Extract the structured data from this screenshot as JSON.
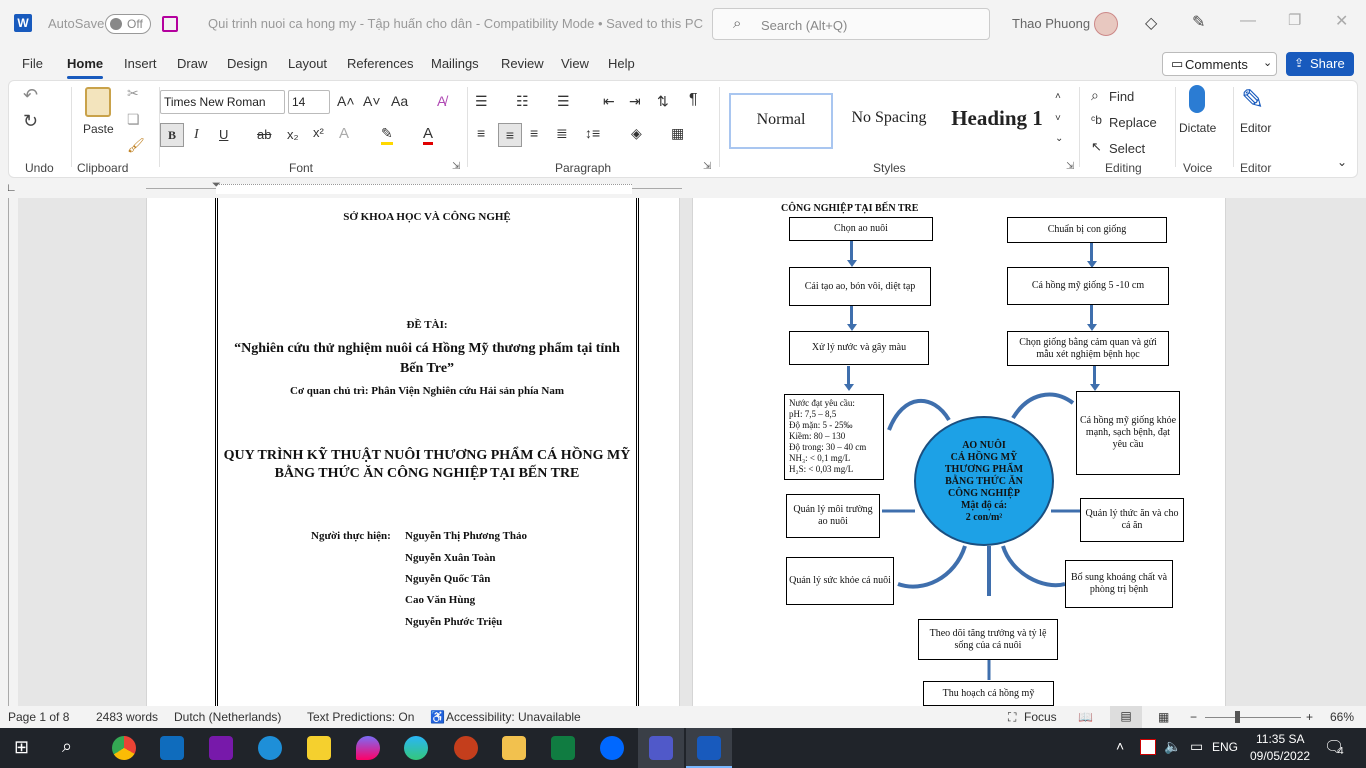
{
  "titlebar": {
    "autosave_label": "AutoSave",
    "autosave_state": "Off",
    "doc_title": "Qui trinh nuoi ca hong my - Tập huấn cho dân  -  Compatibility Mode • Saved to this PC",
    "search_placeholder": "Search (Alt+Q)",
    "user_name": "Thao Phuong"
  },
  "menu": [
    "File",
    "Home",
    "Insert",
    "Draw",
    "Design",
    "Layout",
    "References",
    "Mailings",
    "Review",
    "View",
    "Help"
  ],
  "comments_label": "Comments",
  "share_label": "Share",
  "ribbon": {
    "undo_group": "Undo",
    "clipboard_group": "Clipboard",
    "paste_label": "Paste",
    "font_group": "Font",
    "font_name": "Times New Roman",
    "font_size": "14",
    "paragraph_group": "Paragraph",
    "styles_group": "Styles",
    "styles": [
      "Normal",
      "No Spacing",
      "Heading 1"
    ],
    "editing_group": "Editing",
    "find_label": "Find",
    "replace_label": "Replace",
    "select_label": "Select",
    "voice_group": "Voice",
    "dictate_label": "Dictate",
    "editor_group": "Editor",
    "editor_label": "Editor"
  },
  "page1": {
    "org": "SỞ KHOA HỌC VÀ CÔNG NGHỆ",
    "topic_label": "ĐỀ TÀI:",
    "topic_line1": "“Nghiên cứu thử nghiệm nuôi cá Hồng Mỹ thương phẩm tại tỉnh",
    "topic_line2": "Bến Tre”",
    "host": "Cơ quan chủ trì: Phân Viện Nghiên cứu Hải sản phía Nam",
    "title_line1": "QUY TRÌNH KỸ THUẬT NUÔI THƯƠNG PHẨM CÁ HỒNG MỸ",
    "title_line2": "BẰNG THỨC ĂN CÔNG NGHIỆP TẠI BẾN TRE",
    "authors_label": "Người thực hiện:",
    "authors": [
      "Nguyễn Thị Phương Thảo",
      "Nguyễn Xuân Toàn",
      "Nguyễn Quốc Tân",
      "Cao Văn Hùng",
      "Nguyễn Phước Triệu"
    ]
  },
  "page2": {
    "heading": "CÔNG NGHIỆP TẠI BẾN TRE",
    "box_chon_ao": "Chọn ao nuôi",
    "box_chuan_bi": "Chuẩn bị con giống",
    "box_cai_tao": "Cải tạo ao, bón vôi, diệt tạp",
    "box_ca_giong": "Cá hồng mỹ giống 5 -10 cm",
    "box_xu_ly": "Xử lý nước và gây màu",
    "box_chon_giong": "Chọn giống bằng cảm quan và gửi mẫu xét nghiệm bệnh học",
    "water_req": [
      "Nước đạt yêu cầu:",
      "pH: 7,5 – 8,5",
      "Độ mặn: 5 - 25‰",
      "Kiềm: 80 – 130",
      "Độ trong: 30 – 40 cm",
      "NH₃: < 0,1 mg/L",
      "H₂S: < 0,03 mg/L"
    ],
    "box_giong_khoe": "Cá hồng mỹ giống khỏe mạnh, sạch bệnh, đạt yêu cầu",
    "circle_lines": [
      "AO NUÔI",
      "CÁ HỒNG MỸ",
      "THƯƠNG PHẨM",
      "BẰNG THỨC ĂN",
      "CÔNG NGHIỆP",
      "Mật độ cá:",
      "2 con/m²"
    ],
    "box_ql_moi_truong": "Quản lý môi trường ao nuôi",
    "box_ql_thuc_an": "Quản lý thức ăn và cho cá ăn",
    "box_ql_suc_khoe": "Quản lý sức khỏe cá nuôi",
    "box_bo_sung": "Bổ sung khoáng chất và phòng trị bệnh",
    "box_theo_doi": "Theo dõi tăng trưởng và tỷ lệ sống của cá nuôi",
    "box_thu_hoach": "Thu hoạch cá hồng mỹ"
  },
  "status": {
    "page": "Page 1 of 8",
    "words": "2483 words",
    "language": "Dutch (Netherlands)",
    "predictions": "Text Predictions: On",
    "accessibility": "Accessibility: Unavailable",
    "focus": "Focus",
    "zoom": "66%"
  },
  "taskbar": {
    "language": "ENG",
    "time": "11:35 SA",
    "date": "09/05/2022",
    "notifications": "4"
  }
}
